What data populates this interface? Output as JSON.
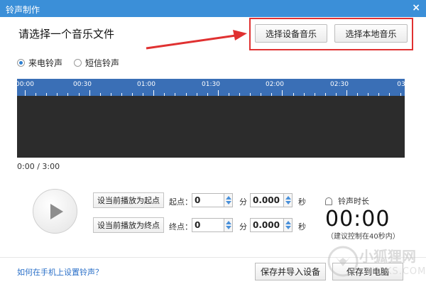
{
  "window": {
    "title": "铃声制作",
    "close": "×"
  },
  "heading": "请选择一个音乐文件",
  "source_buttons": {
    "device": "选择设备音乐",
    "local": "选择本地音乐"
  },
  "ring_type": {
    "options": [
      "来电铃声",
      "短信铃声"
    ],
    "selected": "来电铃声"
  },
  "timeline": {
    "labels": [
      "00:00",
      "00:30",
      "01:00",
      "01:30",
      "02:00",
      "02:30",
      "03"
    ]
  },
  "progress": "0:00 / 3:00",
  "controls": {
    "set_start": "设当前播放为起点",
    "set_end": "设当前播放为终点",
    "start_label": "起点：",
    "end_label": "终点：",
    "start_min": "0",
    "start_sec": "0.000",
    "end_min": "0",
    "end_sec": "0.000",
    "min_unit": "分",
    "sec_unit": "秒"
  },
  "duration": {
    "label": "铃声时长",
    "value": "00:00",
    "hint": "（建议控制在40秒内）"
  },
  "footer": {
    "help": "如何在手机上设置铃声？",
    "save_import": "保存并导入设备",
    "save_pc": "保存到电脑"
  },
  "watermark": {
    "text": "小狐狸网",
    "sub": "XHLKS.COM"
  },
  "colors": {
    "title_bar": "#3b8fd8",
    "timeline": "#3a6fb6",
    "waveform_bg": "#2c2c2c",
    "annotation": "#e03131"
  }
}
